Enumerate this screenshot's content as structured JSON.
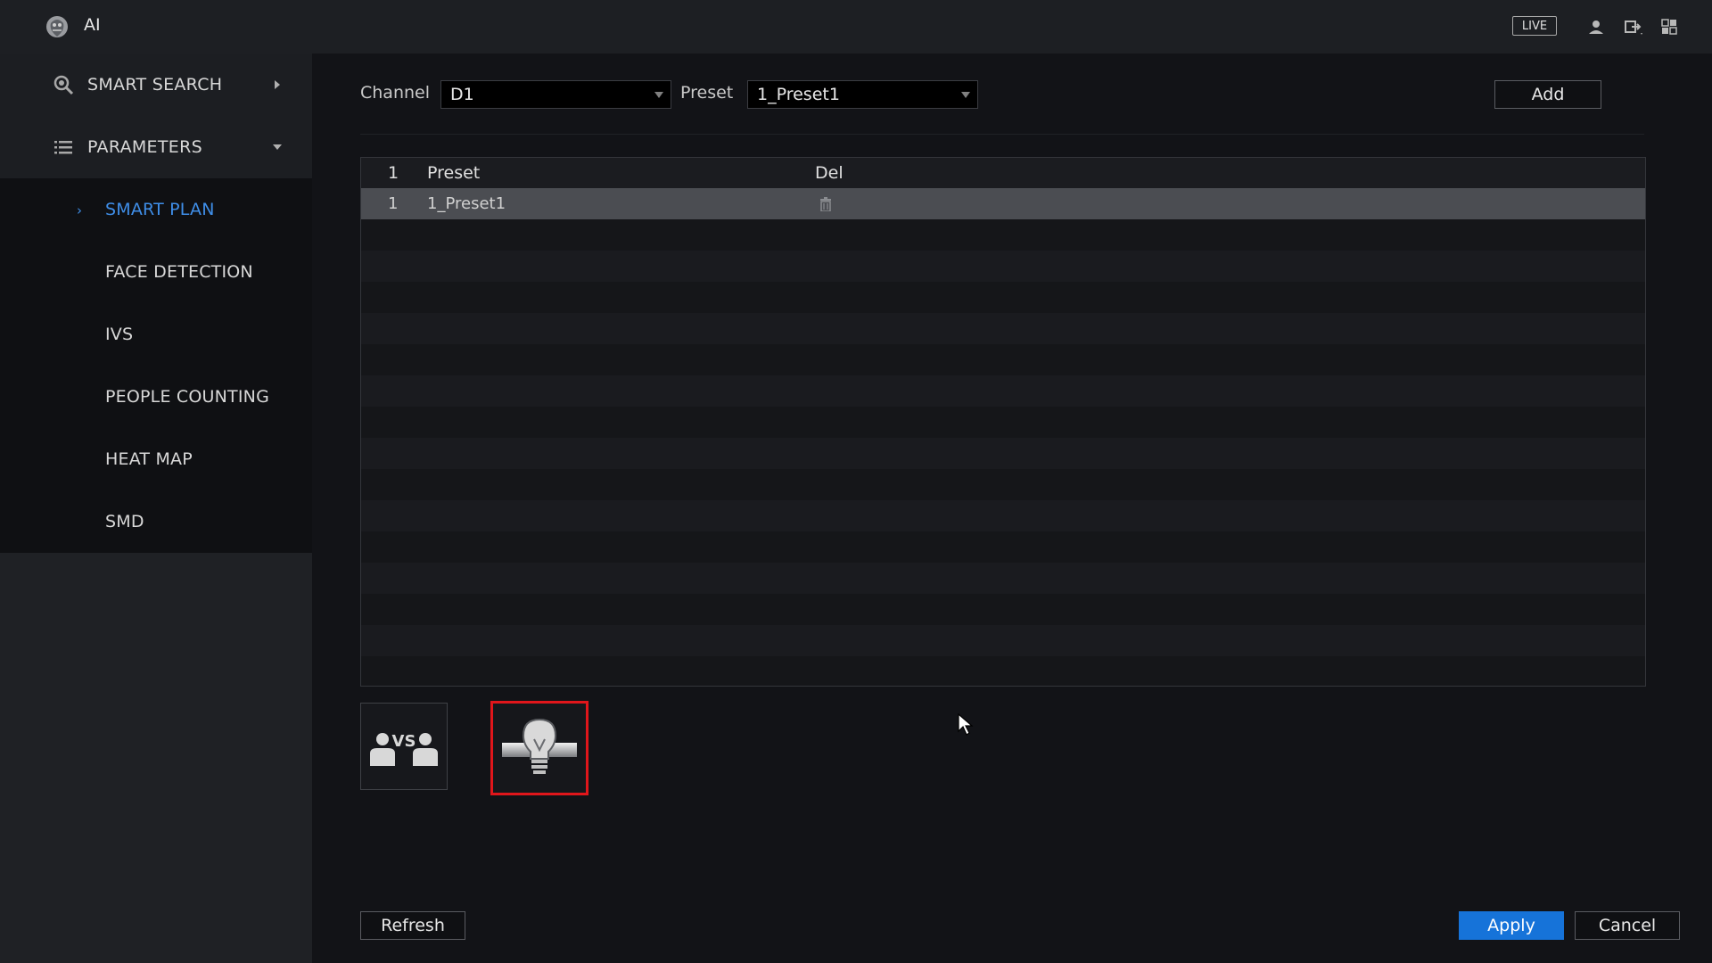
{
  "topbar": {
    "title": "AI",
    "live_label": "LIVE",
    "icons": [
      "ai-logo-icon",
      "user-icon",
      "logout-icon",
      "grid-menu-icon"
    ]
  },
  "sidebar": {
    "menu": [
      {
        "label": "SMART SEARCH",
        "icon": "search-icon",
        "expanded": false
      },
      {
        "label": "PARAMETERS",
        "icon": "list-icon",
        "expanded": true
      }
    ],
    "subitems": [
      {
        "label": "SMART PLAN",
        "active": true
      },
      {
        "label": "FACE DETECTION",
        "active": false
      },
      {
        "label": "IVS",
        "active": false
      },
      {
        "label": "PEOPLE COUNTING",
        "active": false
      },
      {
        "label": "HEAT MAP",
        "active": false
      },
      {
        "label": "SMD",
        "active": false
      }
    ],
    "accent_color": "#3f8ee8"
  },
  "filters": {
    "channel_label": "Channel",
    "channel_value": "D1",
    "preset_label": "Preset",
    "preset_value": "1_Preset1",
    "add_label": "Add"
  },
  "table": {
    "headers": [
      "1",
      "Preset",
      "Del"
    ],
    "rows": [
      {
        "index": "1",
        "preset": "1_Preset1"
      }
    ]
  },
  "tools": [
    {
      "name": "people-counting-tool",
      "label": "VS",
      "selected": false
    },
    {
      "name": "heat-map-tool",
      "selected": true
    }
  ],
  "footer": {
    "refresh_label": "Refresh",
    "apply_label": "Apply",
    "cancel_label": "Cancel"
  },
  "colors": {
    "primary_button": "#1673d9",
    "selection_border": "#e0161b"
  }
}
